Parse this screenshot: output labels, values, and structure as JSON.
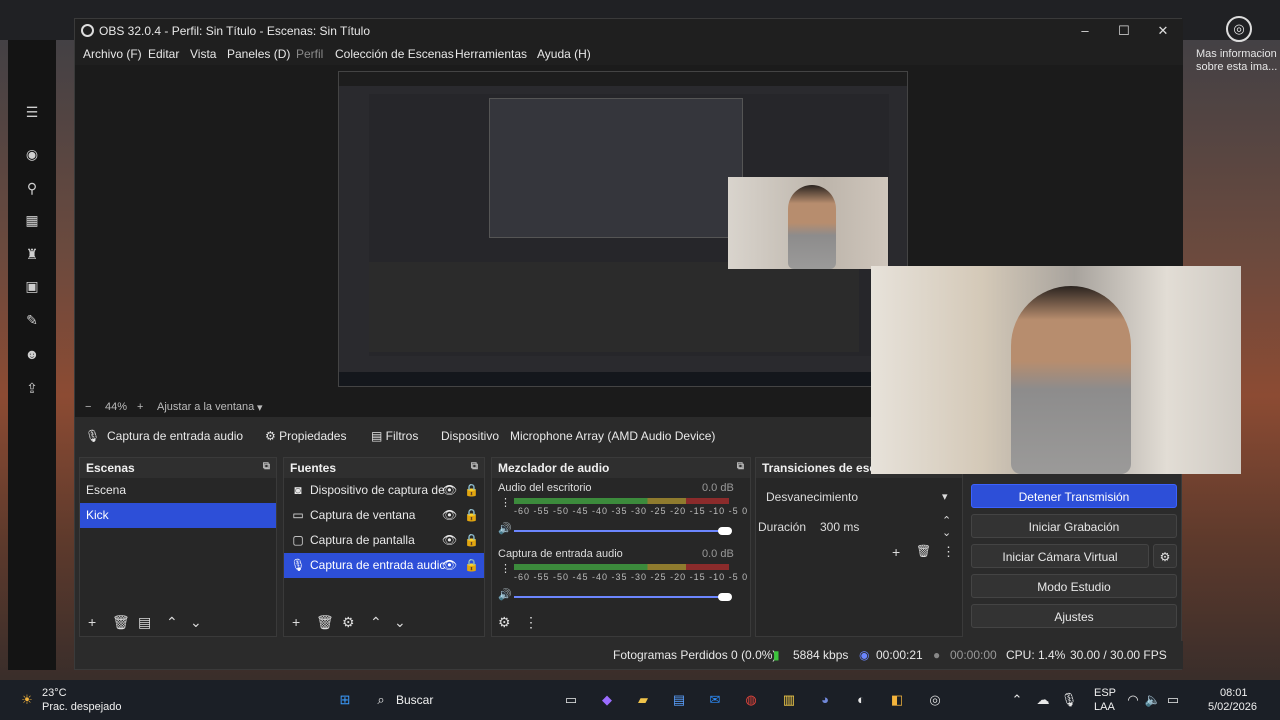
{
  "weather": {
    "temp": "23°C",
    "condition": "Prac. despejado"
  },
  "taskbar": {
    "search_label": "Buscar",
    "lang1": "ESP",
    "lang2": "LAA",
    "time": "08:01",
    "date": "5/02/2026"
  },
  "right_note": {
    "text": "Mas informacion sobre esta ima..."
  },
  "window": {
    "title": "OBS 32.0.4 - Perfil: Sin Título - Escenas: Sin Título"
  },
  "menu": [
    "Archivo (F)",
    "Editar",
    "Vista",
    "Paneles (D)",
    "Perfil",
    "Colección de Escenas",
    "Herramientas",
    "Ayuda (H)"
  ],
  "zoom": {
    "minus": "−",
    "value": "44%",
    "plus": "+",
    "fit_label": "Ajustar a la ventana"
  },
  "source_bar": {
    "source_name": "Captura de entrada audio",
    "properties": "Propiedades",
    "filters": "Filtros",
    "device_label": "Dispositivo",
    "device_value": "Microphone Array (AMD Audio Device)"
  },
  "scenes": {
    "title": "Escenas",
    "items": [
      "Escena",
      "Kick"
    ],
    "selected": 1
  },
  "sources": {
    "title": "Fuentes",
    "items": [
      "Dispositivo de captura de",
      "Captura de ventana",
      "Captura de pantalla",
      "Captura de entrada audic"
    ],
    "selected": 3
  },
  "mixer": {
    "title": "Mezclador de audio",
    "channels": [
      {
        "name": "Audio del escritorio",
        "db": "0.0 dB"
      },
      {
        "name": "Captura de entrada audio",
        "db": "0.0 dB"
      }
    ],
    "scale": "-60 -55 -50 -45 -40 -35 -30 -25 -20 -15 -10 -5 0"
  },
  "transitions": {
    "title": "Transiciones de escena",
    "selected": "Desvanecimiento",
    "duration_label": "Duración",
    "duration_value": "300 ms"
  },
  "controls": {
    "stop_stream": "Detener Transmisión",
    "start_record": "Iniciar Grabación",
    "start_vcam": "Iniciar Cámara Virtual",
    "studio_mode": "Modo Estudio",
    "settings": "Ajustes"
  },
  "status": {
    "dropped": "Fotogramas Perdidos 0 (0.0%)",
    "bitrate": "5884 kbps",
    "stream_time": "00:00:21",
    "rec_time": "00:00:00",
    "cpu": "CPU: 1.4%",
    "fps": "30.00 / 30.00 FPS"
  },
  "colors": {
    "accent": "#2d4fd8",
    "bg": "#2b2b2b"
  }
}
